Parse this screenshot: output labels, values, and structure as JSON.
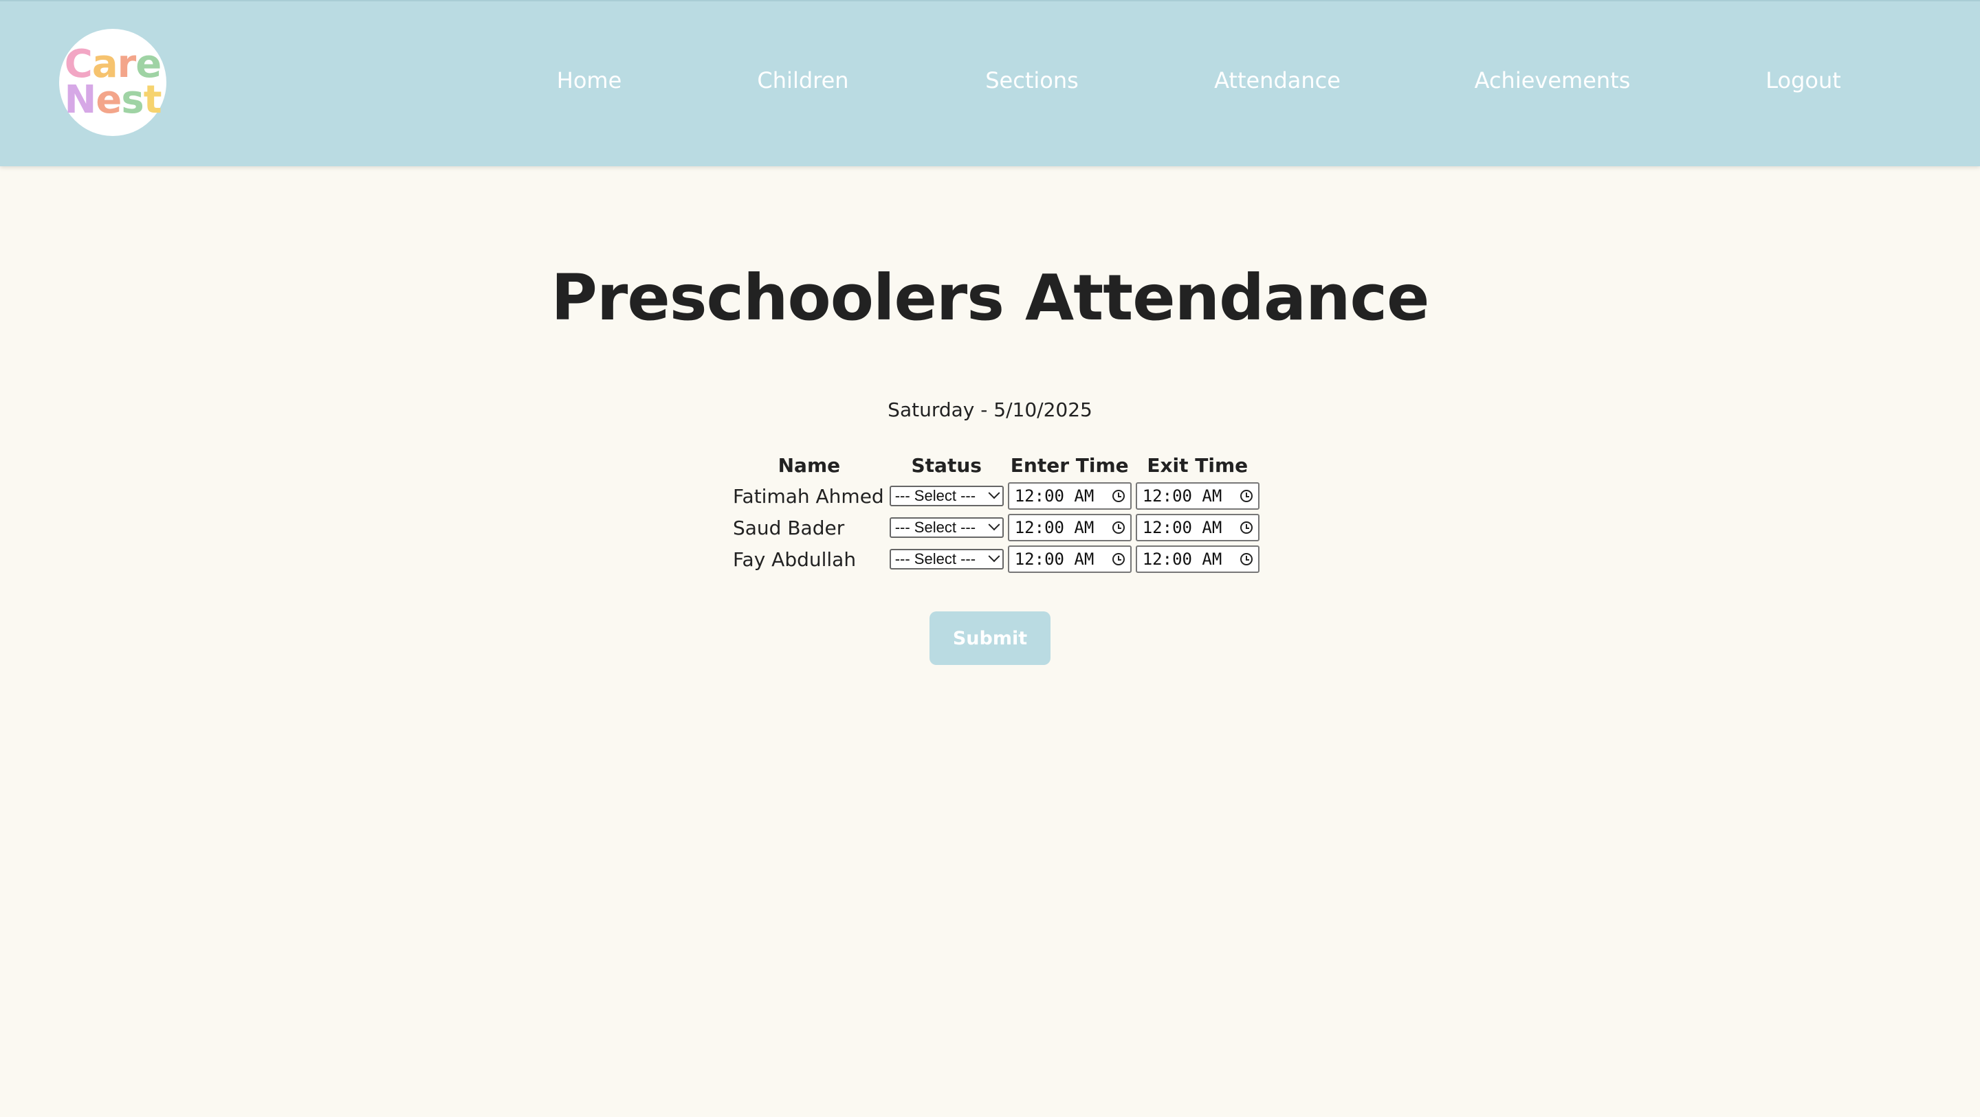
{
  "logo": {
    "line1": [
      "C",
      "a",
      "r",
      "e"
    ],
    "line2": [
      "N",
      "e",
      "s",
      "t"
    ],
    "colors1": [
      "#f2a6c4",
      "#f6c36f",
      "#f3a58a",
      "#9fd3a4"
    ],
    "colors2": [
      "#d6a8e6",
      "#f3a58a",
      "#9fd3a4",
      "#f6d36f"
    ]
  },
  "nav": {
    "home": "Home",
    "children": "Children",
    "sections": "Sections",
    "attendance": "Attendance",
    "achievements": "Achievements",
    "logout": "Logout"
  },
  "page": {
    "title": "Preschoolers Attendance",
    "date": "Saturday - 5/10/2025"
  },
  "table": {
    "headers": {
      "name": "Name",
      "status": "Status",
      "enter": "Enter Time",
      "exit": "Exit Time"
    },
    "rows": [
      {
        "name": "Fatimah Ahmed",
        "status": "--- Select ---",
        "enter": "12:00 AM",
        "exit": "12:00 AM"
      },
      {
        "name": "Saud Bader",
        "status": "--- Select ---",
        "enter": "12:00 AM",
        "exit": "12:00 AM"
      },
      {
        "name": "Fay Abdullah",
        "status": "--- Select ---",
        "enter": "12:00 AM",
        "exit": "12:00 AM"
      }
    ]
  },
  "submit_label": "Submit",
  "colors": {
    "navbar": "#badbe2",
    "background": "#fbf9f2",
    "button": "#badbe2"
  }
}
